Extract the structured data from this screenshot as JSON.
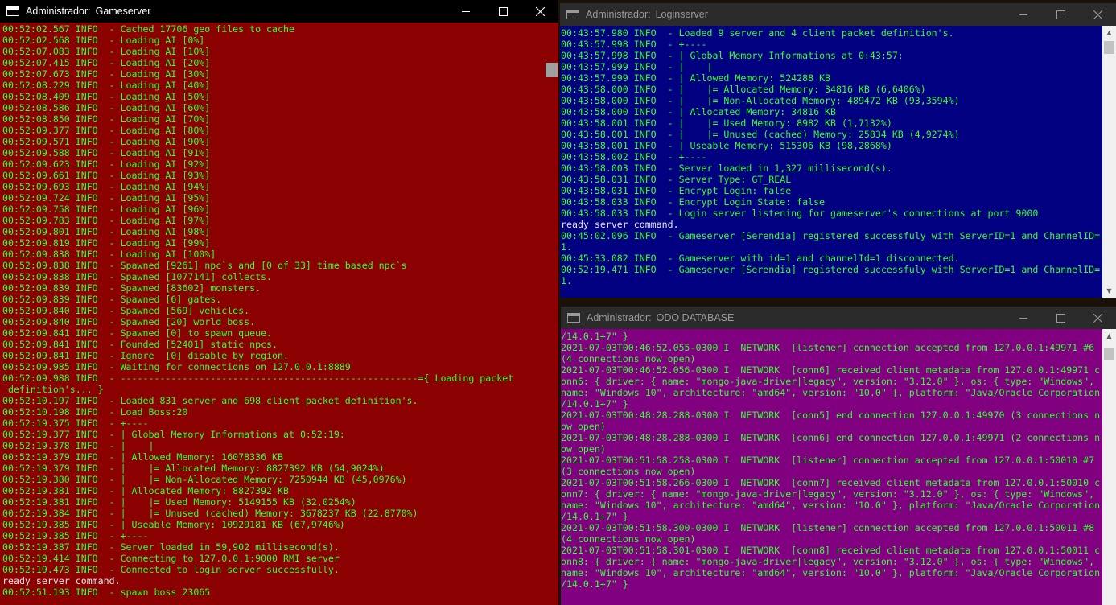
{
  "colors": {
    "gameserver_bg": "#8b0000",
    "loginserver_bg": "#000080",
    "database_bg": "#800080",
    "text_green": "#33ff33",
    "text_white": "#e6e6e6"
  },
  "icons": {
    "minimize": "minimize-icon",
    "maximize": "maximize-icon",
    "close": "close-icon",
    "app": "console-app-icon"
  },
  "gameserver": {
    "title_prefix": "Administrador:",
    "title_name": "Gameserver",
    "lines": [
      "00:52:02.567 INFO  - Cached 17706 geo files to cache",
      "00:52:02.568 INFO  - Loading AI [0%]",
      "00:52:07.083 INFO  - Loading AI [10%]",
      "00:52:07.415 INFO  - Loading AI [20%]",
      "00:52:07.673 INFO  - Loading AI [30%]",
      "00:52:08.229 INFO  - Loading AI [40%]",
      "00:52:08.409 INFO  - Loading AI [50%]",
      "00:52:08.586 INFO  - Loading AI [60%]",
      "00:52:08.850 INFO  - Loading AI [70%]",
      "00:52:09.377 INFO  - Loading AI [80%]",
      "00:52:09.571 INFO  - Loading AI [90%]",
      "00:52:09.588 INFO  - Loading AI [91%]",
      "00:52:09.623 INFO  - Loading AI [92%]",
      "00:52:09.661 INFO  - Loading AI [93%]",
      "00:52:09.693 INFO  - Loading AI [94%]",
      "00:52:09.724 INFO  - Loading AI [95%]",
      "00:52:09.758 INFO  - Loading AI [96%]",
      "00:52:09.783 INFO  - Loading AI [97%]",
      "00:52:09.801 INFO  - Loading AI [98%]",
      "00:52:09.819 INFO  - Loading AI [99%]",
      "00:52:09.838 INFO  - Loading AI [100%]",
      "00:52:09.838 INFO  - Spawned [9261] npc`s and [0 of 33] time based npc`s",
      "00:52:09.838 INFO  - Spawned [1077141] collects.",
      "00:52:09.839 INFO  - Spawned [83602] monsters.",
      "00:52:09.839 INFO  - Spawned [6] gates.",
      "00:52:09.840 INFO  - Spawned [569] vehicles.",
      "00:52:09.840 INFO  - Spawned [20] world boss.",
      "00:52:09.841 INFO  - Spawned [0] to spawn queue.",
      "00:52:09.841 INFO  - Founded [52401] static npcs.",
      "00:52:09.841 INFO  - Ignore  [0] disable by region.",
      "00:52:09.985 INFO  - Waiting for connections on 127.0.0.1:8889",
      "00:52:09.988 INFO  - -----------------------------------------------------={ Loading packet",
      " definition's... }",
      "00:52:10.197 INFO  - Loaded 831 server and 698 client packet definition's.",
      "00:52:10.198 INFO  - Load Boss:20",
      "00:52:19.375 INFO  - +----",
      "00:52:19.377 INFO  - | Global Memory Informations at 0:52:19:",
      "00:52:19.378 INFO  - |    |",
      "00:52:19.379 INFO  - | Allowed Memory: 16078336 KB",
      "00:52:19.379 INFO  - |    |= Allocated Memory: 8827392 KB (54,9024%)",
      "00:52:19.380 INFO  - |    |= Non-Allocated Memory: 7250944 KB (45,0976%)",
      "00:52:19.381 INFO  - | Allocated Memory: 8827392 KB",
      "00:52:19.381 INFO  - |    |= Used Memory: 5149155 KB (32,0254%)",
      "00:52:19.384 INFO  - |    |= Unused (cached) Memory: 3678237 KB (22,8770%)",
      "00:52:19.385 INFO  - | Useable Memory: 10929181 KB (67,9746%)",
      "00:52:19.385 INFO  - +----",
      "00:52:19.387 INFO  - Server loaded in 59,902 millisecond(s).",
      "00:52:19.414 INFO  - Connecting to 127.0.0.1:9000 RMI server",
      "00:52:19.473 INFO  - Connected to login server successfully.",
      "ready server command.",
      "00:52:51.193 INFO  - spawn boss 23065"
    ]
  },
  "loginserver": {
    "title_prefix": "Administrador:",
    "title_name": "Loginserver",
    "lines": [
      "00:43:57.980 INFO  - Loaded 9 server and 4 client packet definition's.",
      "00:43:57.998 INFO  - +----",
      "00:43:57.998 INFO  - | Global Memory Informations at 0:43:57:",
      "00:43:57.999 INFO  - |    |",
      "00:43:57.999 INFO  - | Allowed Memory: 524288 KB",
      "00:43:58.000 INFO  - |    |= Allocated Memory: 34816 KB (6,6406%)",
      "00:43:58.000 INFO  - |    |= Non-Allocated Memory: 489472 KB (93,3594%)",
      "00:43:58.000 INFO  - | Allocated Memory: 34816 KB",
      "00:43:58.001 INFO  - |    |= Used Memory: 8982 KB (1,7132%)",
      "00:43:58.001 INFO  - |    |= Unused (cached) Memory: 25834 KB (4,9274%)",
      "00:43:58.001 INFO  - | Useable Memory: 515306 KB (98,2868%)",
      "00:43:58.002 INFO  - +----",
      "00:43:58.003 INFO  - Server loaded in 1,327 millisecond(s).",
      "00:43:58.031 INFO  - Server Type: GT_REAL",
      "00:43:58.031 INFO  - Encrypt Login: false",
      "00:43:58.033 INFO  - Encrypt Login State: false",
      "00:43:58.033 INFO  - Login server listening for gameserver's connections at port 9000",
      "ready server command.",
      "00:45:02.096 INFO  - Gameserver [Serendia] registered successfuly with ServerID=1 and ChannelID=",
      "1.",
      "00:45:33.082 INFO  - Gameserver with id=1 and channelId=1 disconnected.",
      "00:52:19.471 INFO  - Gameserver [Serendia] registered successfuly with ServerID=1 and ChannelID=",
      "1."
    ]
  },
  "database": {
    "title_prefix": "Administrador:",
    "title_name": "ODO DATABASE",
    "lines": [
      "/14.0.1+7\" }",
      "2021-07-03T00:46:52.055-0300 I  NETWORK  [listener] connection accepted from 127.0.0.1:49971 #6",
      "(4 connections now open)",
      "2021-07-03T00:46:52.056-0300 I  NETWORK  [conn6] received client metadata from 127.0.0.1:49971 c",
      "onn6: { driver: { name: \"mongo-java-driver|legacy\", version: \"3.12.0\" }, os: { type: \"Windows\",",
      "name: \"Windows 10\", architecture: \"amd64\", version: \"10.0\" }, platform: \"Java/Oracle Corporation",
      "/14.0.1+7\" }",
      "2021-07-03T00:48:28.288-0300 I  NETWORK  [conn5] end connection 127.0.0.1:49970 (3 connections n",
      "ow open)",
      "2021-07-03T00:48:28.288-0300 I  NETWORK  [conn6] end connection 127.0.0.1:49971 (2 connections n",
      "ow open)",
      "2021-07-03T00:51:58.258-0300 I  NETWORK  [listener] connection accepted from 127.0.0.1:50010 #7",
      "(3 connections now open)",
      "2021-07-03T00:51:58.266-0300 I  NETWORK  [conn7] received client metadata from 127.0.0.1:50010 c",
      "onn7: { driver: { name: \"mongo-java-driver|legacy\", version: \"3.12.0\" }, os: { type: \"Windows\",",
      "name: \"Windows 10\", architecture: \"amd64\", version: \"10.0\" }, platform: \"Java/Oracle Corporation",
      "/14.0.1+7\" }",
      "2021-07-03T00:51:58.300-0300 I  NETWORK  [listener] connection accepted from 127.0.0.1:50011 #8",
      "(4 connections now open)",
      "2021-07-03T00:51:58.301-0300 I  NETWORK  [conn8] received client metadata from 127.0.0.1:50011 c",
      "onn8: { driver: { name: \"mongo-java-driver|legacy\", version: \"3.12.0\" }, os: { type: \"Windows\",",
      "name: \"Windows 10\", architecture: \"amd64\", version: \"10.0\" }, platform: \"Java/Oracle Corporation",
      "/14.0.1+7\" }"
    ]
  }
}
